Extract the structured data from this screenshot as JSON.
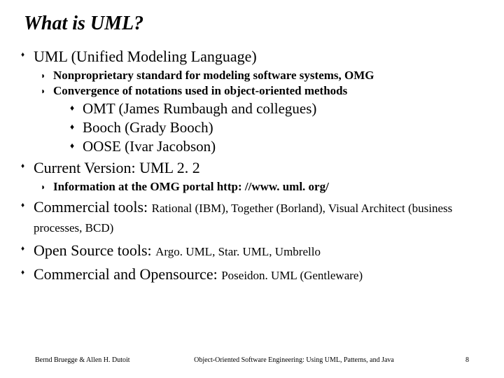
{
  "title": "What is UML?",
  "bullets": {
    "b1": "UML (Unified Modeling Language)",
    "b1a": "Nonproprietary standard for modeling software systems, OMG",
    "b1b": "Convergence of notations used in object-oriented methods",
    "b1b1": "OMT (James Rumbaugh and collegues)",
    "b1b2": "Booch (Grady Booch)",
    "b1b3": "OOSE (Ivar Jacobson)",
    "b2": "Current Version: UML 2. 2",
    "b2a": "Information at the OMG portal http: //www. uml. org/",
    "b3_main": "Commercial tools: ",
    "b3_detail": "Rational (IBM), Together (Borland), Visual Architect (business processes, BCD)",
    "b4_main": "Open Source tools: ",
    "b4_detail": "Argo. UML, Star. UML, Umbrello",
    "b5_main": "Commercial and Opensource: ",
    "b5_detail": "Poseidon. UML (Gentleware)"
  },
  "glyphs": {
    "l1": "♦",
    "l2": "◗",
    "l3": "♦"
  },
  "footer": {
    "left": "Bernd Bruegge & Allen H. Dutoit",
    "center": "Object-Oriented Software Engineering: Using UML, Patterns, and Java",
    "right": "8"
  }
}
